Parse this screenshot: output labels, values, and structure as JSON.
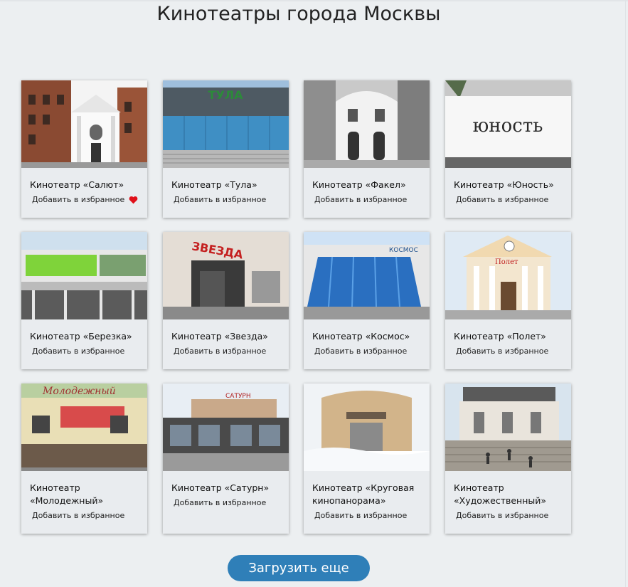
{
  "page": {
    "title": "Кинотеатры города Москвы"
  },
  "cinemas": [
    {
      "name": "Кинотеатр «Салют»",
      "fav_label": "Добавить в избранное",
      "favorited": true
    },
    {
      "name": "Кинотеатр «Тула»",
      "fav_label": "Добавить в избранное",
      "favorited": false
    },
    {
      "name": "Кинотеатр «Факел»",
      "fav_label": "Добавить в избранное",
      "favorited": false
    },
    {
      "name": "Кинотеатр «Юность»",
      "fav_label": "Добавить в избранное",
      "favorited": false
    },
    {
      "name": "Кинотеатр «Березка»",
      "fav_label": "Добавить в избранное",
      "favorited": false
    },
    {
      "name": "Кинотеатр «Звезда»",
      "fav_label": "Добавить в избранное",
      "favorited": false
    },
    {
      "name": "Кинотеатр «Космос»",
      "fav_label": "Добавить в избранное",
      "favorited": false
    },
    {
      "name": "Кинотеатр «Полет»",
      "fav_label": "Добавить в избранное",
      "favorited": false
    },
    {
      "name": "Кинотеатр «Молодежный»",
      "fav_label": "Добавить в избранное",
      "favorited": false
    },
    {
      "name": "Кинотеатр «Сатурн»",
      "fav_label": "Добавить в избранное",
      "favorited": false
    },
    {
      "name": "Кинотеатр «Круговая кинопанорама»",
      "fav_label": "Добавить в избранное",
      "favorited": false
    },
    {
      "name": "Кинотеатр «Художественный»",
      "fav_label": "Добавить в избранное",
      "favorited": false
    }
  ],
  "photo_signs": {
    "tula": "ТУЛА",
    "yunost": "юность",
    "zvezda": "ЗВЕЗДА",
    "kosmos": "КОСМОС",
    "polet": "Полет",
    "molodezhny": "Молодежный",
    "saturn": "САТУРН"
  },
  "colors": {
    "accent": "#2f7fb8",
    "heart": "#e0101a"
  },
  "load_more": {
    "label": "Загрузить еще"
  }
}
